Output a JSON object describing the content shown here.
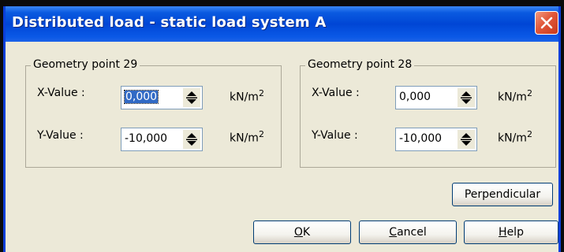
{
  "dialog": {
    "title": "Distributed load - static load system A"
  },
  "groups": [
    {
      "legend": "Geometry point 29",
      "x_label": "X-Value :",
      "x_value": "0,000",
      "y_label": "Y-Value :",
      "y_value": "-10,000",
      "unit_base": "kN/m",
      "unit_exp": "2"
    },
    {
      "legend": "Geometry point 28",
      "x_label": "X-Value :",
      "x_value": "0,000",
      "y_label": "Y-Value :",
      "y_value": "-10,000",
      "unit_base": "kN/m",
      "unit_exp": "2"
    }
  ],
  "buttons": {
    "perpendicular": "Perpendicular",
    "ok_mnemonic": "O",
    "ok_rest": "K",
    "cancel_mnemonic": "C",
    "cancel_rest": "ancel",
    "help_mnemonic": "H",
    "help_rest": "elp"
  },
  "icons": {
    "close": "close-icon",
    "spinner": "spinner-arrows-icon"
  },
  "colors": {
    "titlebar": "#0046d5",
    "face": "#ece9d8",
    "close": "#e1573a",
    "selection": "#316ac5"
  }
}
